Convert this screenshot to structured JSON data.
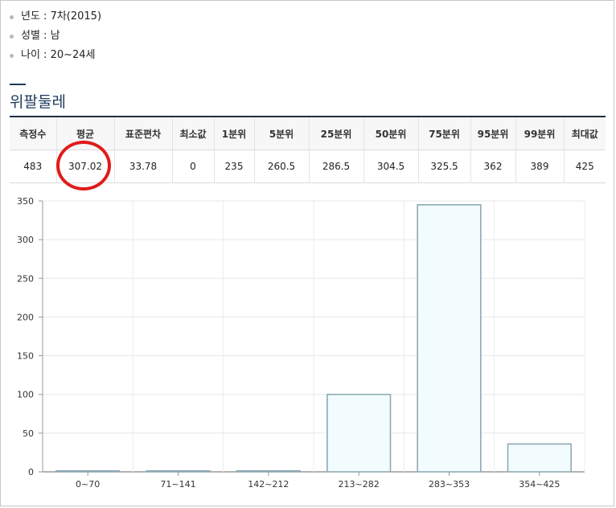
{
  "meta": {
    "items": [
      {
        "label": "년도 : 7차(2015)"
      },
      {
        "label": "성별 : 남"
      },
      {
        "label": "나이 : 20~24세"
      }
    ]
  },
  "section": {
    "title": "위팔둘레"
  },
  "stats": {
    "headers": [
      "측정수",
      "평균",
      "표준편차",
      "최소값",
      "1분위",
      "5분위",
      "25분위",
      "50분위",
      "75분위",
      "95분위",
      "99분위",
      "최대값"
    ],
    "values": [
      "483",
      "307.02",
      "33.78",
      "0",
      "235",
      "260.5",
      "286.5",
      "304.5",
      "325.5",
      "362",
      "389",
      "425"
    ]
  },
  "colors": {
    "accent": "#1f3a5f",
    "bar_fill": "#f2fbfd",
    "bar_stroke": "#8eaab4",
    "highlight": "#e11b1b"
  },
  "chart_data": {
    "type": "bar",
    "categories": [
      "0~70",
      "71~141",
      "142~212",
      "213~282",
      "283~353",
      "354~425"
    ],
    "values": [
      1,
      0,
      0,
      100,
      345,
      36
    ],
    "ylim": [
      0,
      350
    ],
    "yticks": [
      0,
      50,
      100,
      150,
      200,
      250,
      300,
      350
    ],
    "grid": true,
    "legend": "none"
  }
}
